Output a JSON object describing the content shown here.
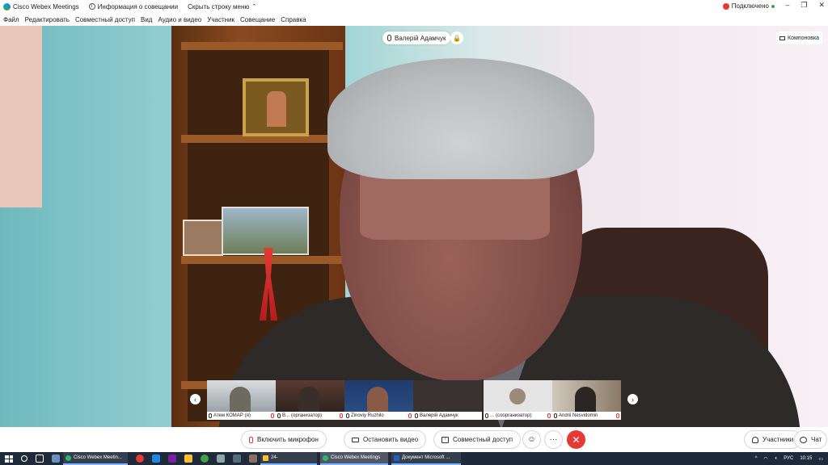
{
  "window": {
    "title": "Cisco Webex Meetings",
    "meeting_info": "Информация о совещании",
    "hide_menu": "Скрыть строку меню",
    "status": "Подключено"
  },
  "menu": [
    "Файл",
    "Редактировать",
    "Совместный доступ",
    "Вид",
    "Аудио и видео",
    "Участник",
    "Совещание",
    "Справка"
  ],
  "video": {
    "active_speaker": "Валерій Адамчук",
    "layout_label": "Компоновка"
  },
  "thumbnails": [
    {
      "name": "Атем КОМАР",
      "suffix": "(я)"
    },
    {
      "name": "В...",
      "suffix": "(организатор)"
    },
    {
      "name": "Zinoviy Ruzhilo",
      "suffix": ""
    },
    {
      "name": "Валерій Адамчук",
      "suffix": ""
    },
    {
      "name": "...",
      "suffix": "(соорганизатор)"
    },
    {
      "name": "Andrii Nesvidomin",
      "suffix": ""
    }
  ],
  "controls": {
    "mic": "Включить микрофон",
    "video": "Остановить видео",
    "share": "Совместный доступ",
    "participants": "Участники",
    "chat": "Чат"
  },
  "taskbar": {
    "apps": [
      "Cisco Webex Meetin...",
      "24-",
      "Cisco Webex Meetings",
      "Документ Microsoft ..."
    ],
    "lang": "РУС",
    "time": "10:15"
  }
}
